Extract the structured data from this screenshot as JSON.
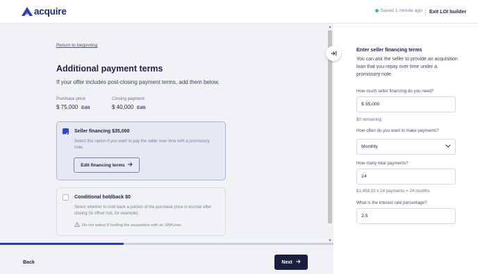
{
  "header": {
    "logo_text": "acquire",
    "save_status": "Saved 1 minute ago",
    "exit_label": "Exit LOI builder",
    "status_color": "#38c172"
  },
  "main": {
    "return_link": "Return to beginning",
    "title": "Additional payment terms",
    "subtitle": "If your offer includes post-closing payment terms, add them below.",
    "purchase_price": {
      "label": "Purchase price",
      "value": "$ 75,000",
      "edit": "Edit"
    },
    "closing_payment": {
      "label": "Closing payment",
      "value": "$ 40,000",
      "edit": "Edit"
    },
    "seller_financing": {
      "checked": true,
      "title": "Seller financing $35,000",
      "description": "Select this option if you want to pay the seller over time with a promissory note.",
      "edit_button": "Edit financing terms"
    },
    "holdback": {
      "checked": false,
      "title": "Conditional holdback $0",
      "description": "Select whether to hold back a portion of the purchase price in escrow after closing (to offset risk, for example).",
      "warning": "Do not select if funding the acquisition with an SBA loan"
    },
    "progress_fraction": 0.37,
    "back_label": "Back",
    "next_label": "Next"
  },
  "panel": {
    "title": "Enter seller financing terms",
    "description": "You can ask the seller to provide an acquisition loan that you repay over time under a promissory note.",
    "amount_label": "How much seller financing do you need?",
    "amount_value": "$ 35,000",
    "remaining": "$0 remaining",
    "frequency_label": "How often do you want to make payments?",
    "frequency_value": "Monthly",
    "total_label": "How many total payments?",
    "total_value": "24",
    "payment_summary": "$1,458.33 x 24 payments = 24 months",
    "rate_label": "What is the interest rate percentage?",
    "rate_value": "2.5"
  },
  "colors": {
    "brand": "#1e2a6e",
    "accent": "#3345c4",
    "dark_button": "#1a1f3e"
  },
  "icons": {
    "logo": "acquire-logo-icon",
    "collapse": "collapse-panel-icon",
    "arrow": "arrow-right-icon",
    "warning": "warning-icon",
    "chevron": "chevron-down-icon",
    "check": "check-icon"
  }
}
